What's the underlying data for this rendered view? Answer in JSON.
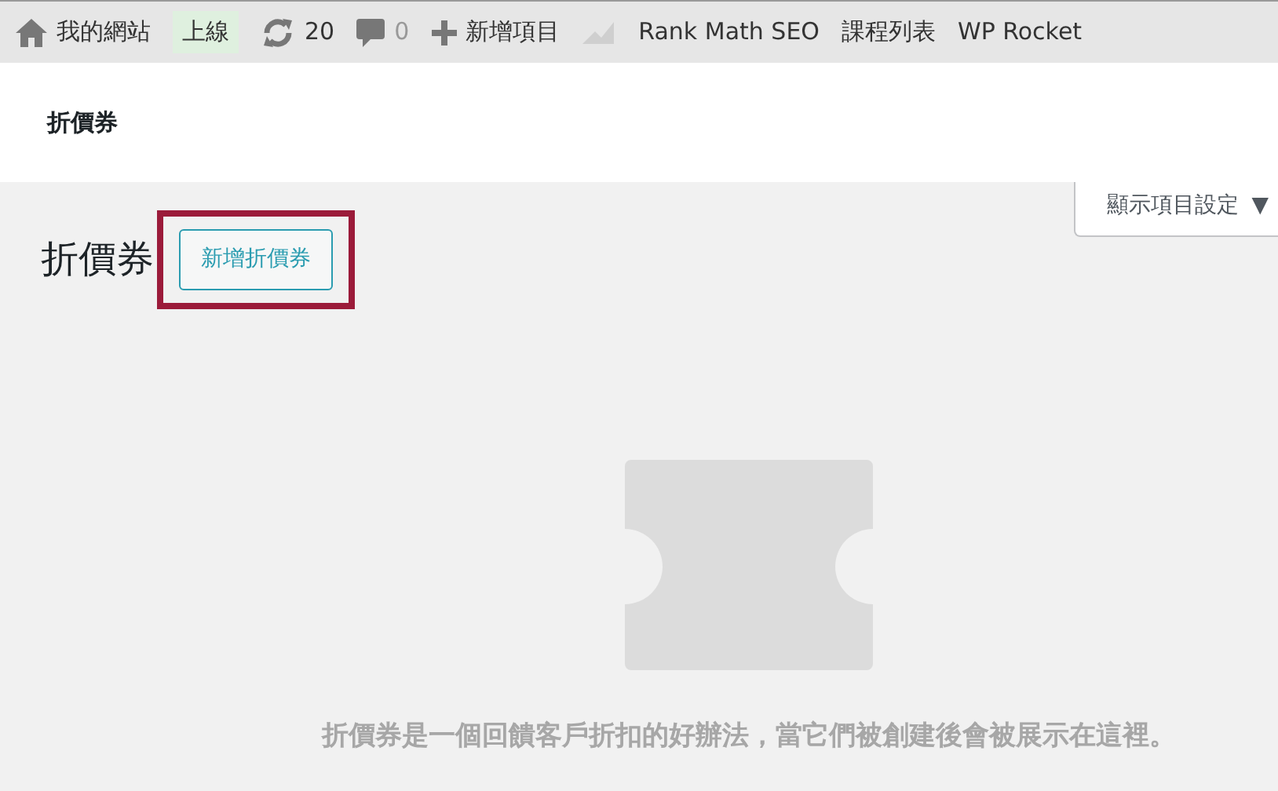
{
  "admin_bar": {
    "site_name": "我的網站",
    "status_badge": "上線",
    "updates_count": "20",
    "comments_count": "0",
    "new_item": "新增項目",
    "menu_items": [
      "Rank Math SEO",
      "課程列表",
      "WP Rocket"
    ]
  },
  "header": {
    "title": "折價券"
  },
  "screen_options": {
    "label": "顯示項目設定",
    "caret": "▼"
  },
  "page": {
    "title": "折價券",
    "add_button": {
      "label": "新增折價券",
      "highlighted": true
    }
  },
  "empty_state": {
    "message": "折價券是一個回饋客戶折扣的好辦法，當它們被創建後會被展示在這裡。"
  }
}
